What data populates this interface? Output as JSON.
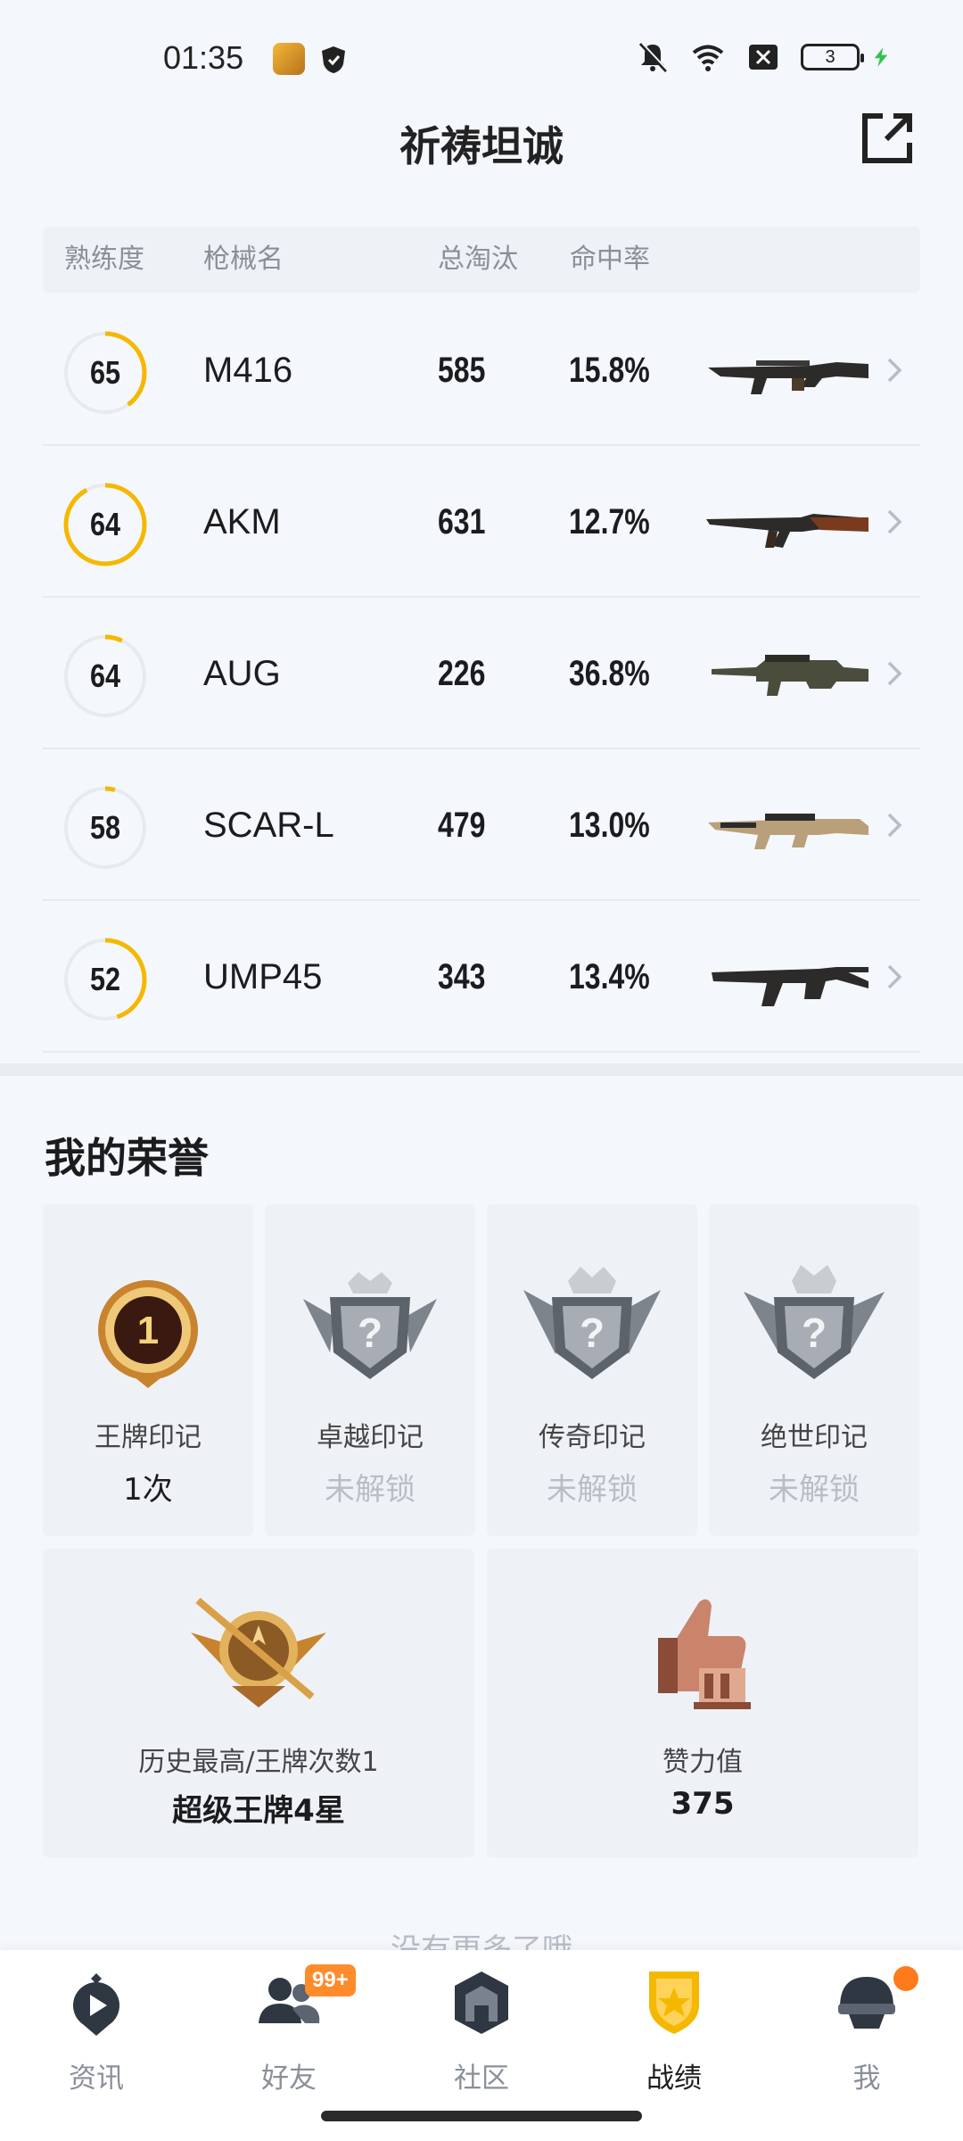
{
  "status_bar": {
    "time": "01:35",
    "battery": "3"
  },
  "header": {
    "title": "祈祷坦诚"
  },
  "table": {
    "columns": {
      "proficiency": "熟练度",
      "weapon": "枪械名",
      "kills": "总淘汰",
      "accuracy": "命中率"
    },
    "rows": [
      {
        "level": "65",
        "name": "M416",
        "kills": "585",
        "accuracy": "15.8%",
        "progress": 0.4,
        "gun": "m416-icon"
      },
      {
        "level": "64",
        "name": "AKM",
        "kills": "631",
        "accuracy": "12.7%",
        "progress": 0.92,
        "gun": "akm-icon"
      },
      {
        "level": "64",
        "name": "AUG",
        "kills": "226",
        "accuracy": "36.8%",
        "progress": 0.07,
        "gun": "aug-icon"
      },
      {
        "level": "58",
        "name": "SCAR-L",
        "kills": "479",
        "accuracy": "13.0%",
        "progress": 0.04,
        "gun": "scar-l-icon"
      },
      {
        "level": "52",
        "name": "UMP45",
        "kills": "343",
        "accuracy": "13.4%",
        "progress": 0.45,
        "gun": "ump45-icon"
      }
    ]
  },
  "honors": {
    "title": "我的荣誉",
    "marks": [
      {
        "label": "王牌印记",
        "value": "1次",
        "locked": false,
        "icon": "ace-medal-icon"
      },
      {
        "label": "卓越印记",
        "value": "未解锁",
        "locked": true,
        "icon": "locked-crown-badge-icon"
      },
      {
        "label": "传奇印记",
        "value": "未解锁",
        "locked": true,
        "icon": "locked-crown-badge-icon"
      },
      {
        "label": "绝世印记",
        "value": "未解锁",
        "locked": true,
        "icon": "locked-crown-badge-icon"
      }
    ],
    "rank": {
      "label": "历史最高/王牌次数1",
      "value": "超级王牌4星",
      "icon": "rank-emblem-icon"
    },
    "effort": {
      "label": "赞力值",
      "value": "375",
      "icon": "thumbs-up-trophy-icon"
    }
  },
  "end_hint": "没有更多了哦",
  "bottom_nav": {
    "items": [
      {
        "label": "资讯",
        "active": false,
        "icon": "news-play-icon"
      },
      {
        "label": "好友",
        "active": false,
        "icon": "friends-icon",
        "badge": "99+"
      },
      {
        "label": "社区",
        "active": false,
        "icon": "community-icon"
      },
      {
        "label": "战绩",
        "active": true,
        "icon": "record-shield-icon"
      },
      {
        "label": "我",
        "active": false,
        "icon": "helmet-icon",
        "dot": true
      }
    ]
  },
  "colors": {
    "accent": "#f5b800",
    "locked_text": "#b9bec6",
    "badge_orange": "#ff8b2b"
  }
}
